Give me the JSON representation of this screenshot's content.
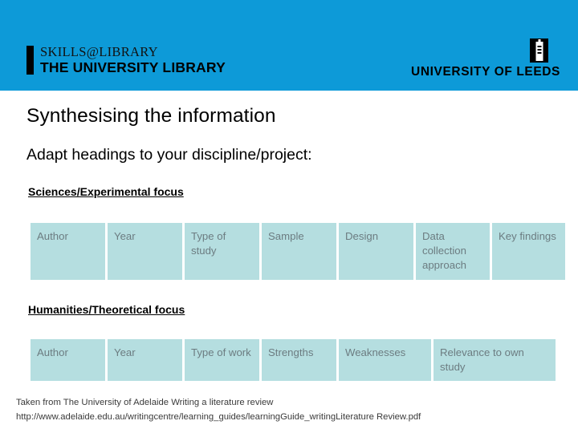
{
  "header": {
    "background_color": "#0d9ad8",
    "brand_left": {
      "line1": "SKILLS@LIBRARY",
      "line2": "THE UNIVERSITY LIBRARY",
      "bar_icon": "vertical-bar-icon"
    },
    "brand_right": {
      "name": "UNIVERSITY OF LEEDS",
      "mark_icon": "leeds-tower-icon"
    }
  },
  "slide": {
    "title": "Synthesising the information",
    "subtitle": "Adapt headings to your discipline/project:"
  },
  "sections": [
    {
      "heading": "Sciences/Experimental focus",
      "table": {
        "headers": [
          "Author",
          "Year",
          "Type of study",
          "Sample",
          "Design",
          "Data collection approach",
          "Key findings"
        ],
        "rows": [],
        "cell_color": "#b5dee0",
        "text_color": "#6c7c81"
      }
    },
    {
      "heading": "Humanities/Theoretical focus",
      "table": {
        "headers": [
          "Author",
          "Year",
          "Type of work",
          "Strengths",
          "Weaknesses",
          "Relevance to own study"
        ],
        "rows": [],
        "cell_color": "#b5dee0",
        "text_color": "#6c7c81"
      }
    }
  ],
  "footer": {
    "line1": "Taken from The University of Adelaide Writing a literature review",
    "line2": "http://www.adelaide.edu.au/writingcentre/learning_guides/learningGuide_writingLiterature Review.pdf"
  }
}
